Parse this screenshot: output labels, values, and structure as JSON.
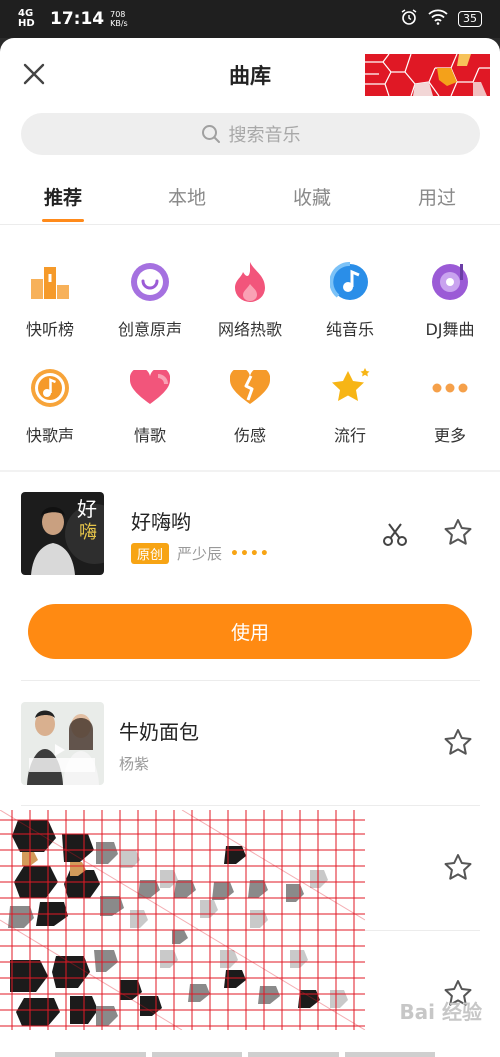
{
  "status_bar": {
    "network": "4G HD",
    "time": "17:14",
    "speed": "708 KB/s",
    "battery": "35"
  },
  "header": {
    "title": "曲库"
  },
  "search": {
    "placeholder": "搜索音乐"
  },
  "tabs": [
    {
      "label": "推荐",
      "active": true
    },
    {
      "label": "本地",
      "active": false
    },
    {
      "label": "收藏",
      "active": false
    },
    {
      "label": "用过",
      "active": false
    }
  ],
  "categories": [
    {
      "label": "快听榜",
      "icon": "podium-icon"
    },
    {
      "label": "创意原声",
      "icon": "smile-icon"
    },
    {
      "label": "网络热歌",
      "icon": "flame-icon"
    },
    {
      "label": "纯音乐",
      "icon": "note-circle-icon"
    },
    {
      "label": "DJ舞曲",
      "icon": "vinyl-icon"
    },
    {
      "label": "快歌声",
      "icon": "music-note-icon"
    },
    {
      "label": "情歌",
      "icon": "heart-icon"
    },
    {
      "label": "伤感",
      "icon": "broken-heart-icon"
    },
    {
      "label": "流行",
      "icon": "star-icon"
    },
    {
      "label": "更多",
      "icon": "more-dots-icon"
    }
  ],
  "songs": [
    {
      "title": "好嗨哟",
      "tag": "原创",
      "artist": "严少辰",
      "extra": "••••"
    },
    {
      "title": "牛奶面包",
      "artist": "杨紫"
    }
  ],
  "use_button": "使用",
  "watermark": "Bai 经验",
  "colors": {
    "accent": "#ff8a12",
    "tag": "#f7a414",
    "pink": "#f2557b",
    "purple": "#9b5bd6",
    "blue": "#2a8ee8"
  }
}
